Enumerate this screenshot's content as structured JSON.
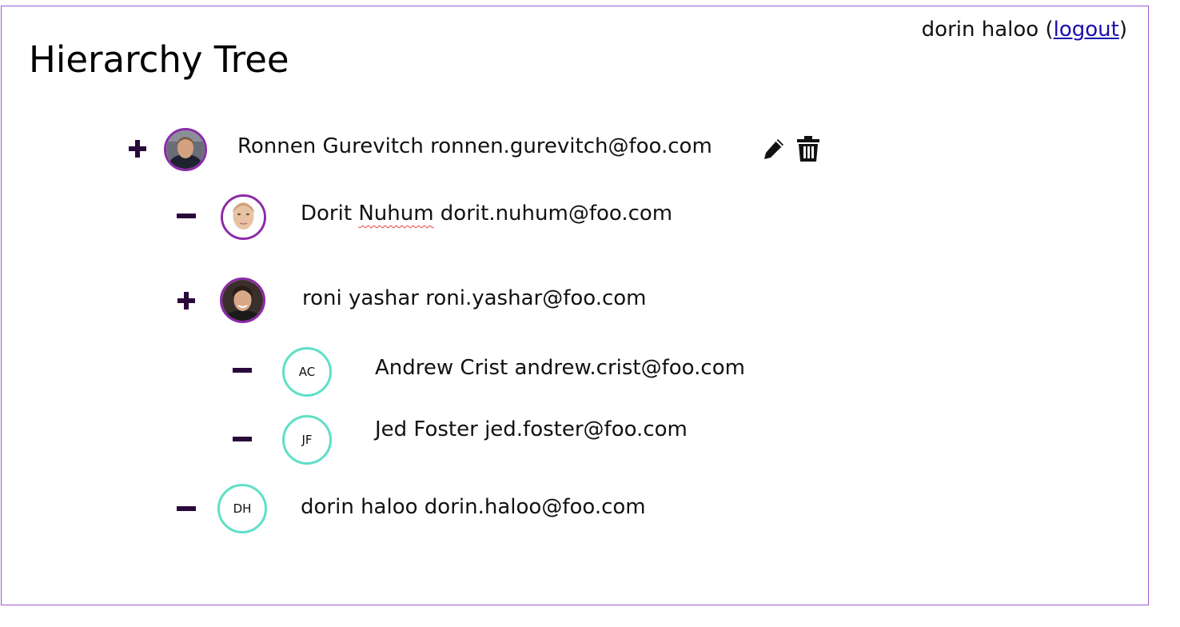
{
  "header": {
    "user_name": "dorin haloo",
    "logout_label": "logout",
    "title": "Hierarchy Tree"
  },
  "colors": {
    "frame": "#9b59d6",
    "photo_ring": "#8b2aa8",
    "initials_ring": "#5ee0c7",
    "toggle": "#2a0a3a"
  },
  "tree": [
    {
      "name": "Ronnen Gurevitch",
      "email": "ronnen.gurevitch@foo.com",
      "toggle": "plus",
      "avatar": "photo",
      "actions": [
        "pencil-icon",
        "trash-icon"
      ]
    },
    {
      "name": "Dorit",
      "name_last": "Nuhum",
      "email": "dorit.nuhum@foo.com",
      "toggle": "minus",
      "avatar": "photo"
    },
    {
      "name": "roni yashar",
      "email": "roni.yashar@foo.com",
      "toggle": "plus",
      "avatar": "photo"
    },
    {
      "name": "Andrew Crist",
      "email": "andrew.crist@foo.com",
      "toggle": "minus",
      "avatar": "initials",
      "initials": "AC"
    },
    {
      "name": "Jed Foster",
      "email": "jed.foster@foo.com",
      "toggle": "minus",
      "avatar": "initials",
      "initials": "JF"
    },
    {
      "name": "dorin haloo",
      "email": "dorin.haloo@foo.com",
      "toggle": "minus",
      "avatar": "initials",
      "initials": "DH"
    }
  ]
}
